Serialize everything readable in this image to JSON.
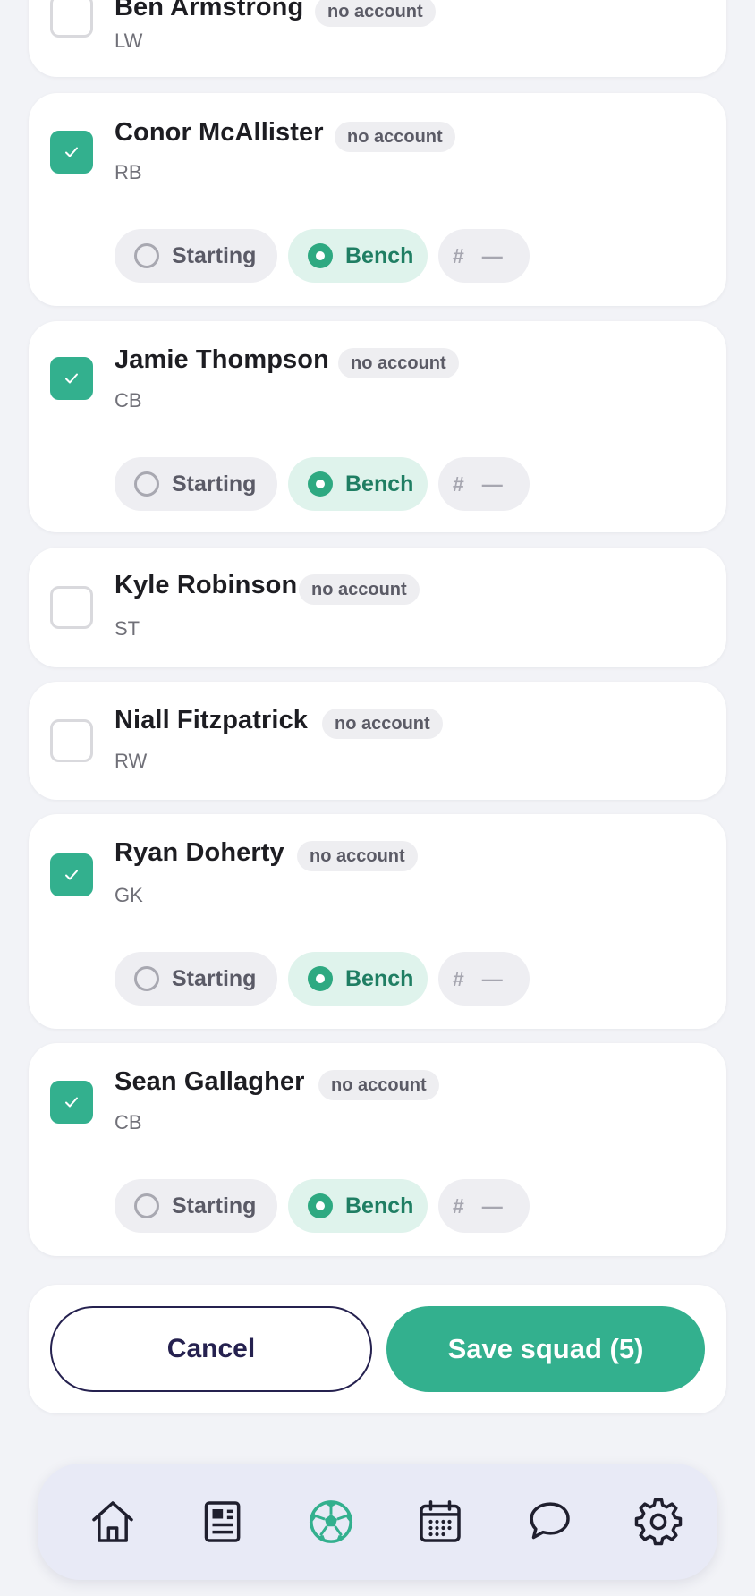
{
  "colors": {
    "accent": "#33b08e",
    "accent_dark": "#1f7e63",
    "navy": "#25214f"
  },
  "players": [
    {
      "name": "Ben Armstrong",
      "badge": "no account",
      "position": "LW",
      "selected": false
    },
    {
      "name": "Conor McAllister",
      "badge": "no account",
      "position": "RB",
      "selected": true,
      "role_options": {
        "starting": "Starting",
        "bench": "Bench",
        "selected_role": "Bench",
        "number_symbol": "#",
        "number_value": "—"
      }
    },
    {
      "name": "Jamie Thompson",
      "badge": "no account",
      "position": "CB",
      "selected": true,
      "role_options": {
        "starting": "Starting",
        "bench": "Bench",
        "selected_role": "Bench",
        "number_symbol": "#",
        "number_value": "—"
      }
    },
    {
      "name": "Kyle Robinson",
      "badge": "no account",
      "position": "ST",
      "selected": false
    },
    {
      "name": "Niall Fitzpatrick",
      "badge": "no account",
      "position": "RW",
      "selected": false
    },
    {
      "name": "Ryan Doherty",
      "badge": "no account",
      "position": "GK",
      "selected": true,
      "role_options": {
        "starting": "Starting",
        "bench": "Bench",
        "selected_role": "Bench",
        "number_symbol": "#",
        "number_value": "—"
      }
    },
    {
      "name": "Sean Gallagher",
      "badge": "no account",
      "position": "CB",
      "selected": true,
      "role_options": {
        "starting": "Starting",
        "bench": "Bench",
        "selected_role": "Bench",
        "number_symbol": "#",
        "number_value": "—"
      }
    }
  ],
  "actions": {
    "cancel_label": "Cancel",
    "save_label": "Save squad (5)"
  },
  "nav": {
    "items": [
      {
        "icon": "home-icon",
        "active": false
      },
      {
        "icon": "news-icon",
        "active": false
      },
      {
        "icon": "football-icon",
        "active": true
      },
      {
        "icon": "calendar-icon",
        "active": false
      },
      {
        "icon": "chat-icon",
        "active": false
      },
      {
        "icon": "gear-icon",
        "active": false
      }
    ]
  }
}
